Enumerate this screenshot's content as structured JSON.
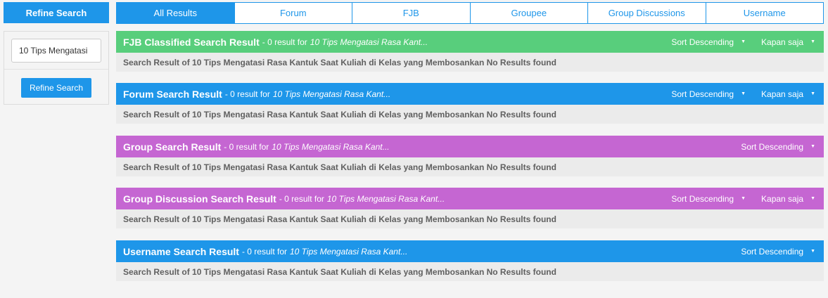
{
  "sidebar": {
    "header": "Refine Search",
    "input_value": "10 Tips Mengatasi",
    "button_label": "Refine Search"
  },
  "tabs": [
    {
      "label": "All Results",
      "active": true
    },
    {
      "label": "Forum",
      "active": false
    },
    {
      "label": "FJB",
      "active": false
    },
    {
      "label": "Groupee",
      "active": false
    },
    {
      "label": "Group Discussions",
      "active": false
    },
    {
      "label": "Username",
      "active": false
    }
  ],
  "sections": [
    {
      "title": "FJB Classified Search Result",
      "meta": "- 0 result for",
      "query": "10 Tips Mengatasi Rasa Kant...",
      "sort_label": "Sort Descending",
      "time_label": "Kapan saja",
      "message": "Search Result of 10 Tips Mengatasi Rasa Kantuk Saat Kuliah di Kelas yang Membosankan No Results found",
      "color": "#58ce7c"
    },
    {
      "title": "Forum Search Result",
      "meta": "- 0 result for",
      "query": "10 Tips Mengatasi Rasa Kant...",
      "sort_label": "Sort Descending",
      "time_label": "Kapan saja",
      "message": "Search Result of 10 Tips Mengatasi Rasa Kantuk Saat Kuliah di Kelas yang Membosankan No Results found",
      "color": "#1e96e9"
    },
    {
      "title": "Group Search Result",
      "meta": "- 0 result for",
      "query": "10 Tips Mengatasi Rasa Kant...",
      "sort_label": "Sort Descending",
      "message": "Search Result of 10 Tips Mengatasi Rasa Kantuk Saat Kuliah di Kelas yang Membosankan No Results found",
      "color": "#c566d2"
    },
    {
      "title": "Group Discussion Search Result",
      "meta": "- 0 result for",
      "query": "10 Tips Mengatasi Rasa Kant...",
      "sort_label": "Sort Descending",
      "time_label": "Kapan saja",
      "message": "Search Result of 10 Tips Mengatasi Rasa Kantuk Saat Kuliah di Kelas yang Membosankan No Results found",
      "color": "#c566d2"
    },
    {
      "title": "Username Search Result",
      "meta": "- 0 result for",
      "query": "10 Tips Mengatasi Rasa Kant...",
      "sort_label": "Sort Descending",
      "message": "Search Result of 10 Tips Mengatasi Rasa Kantuk Saat Kuliah di Kelas yang Membosankan No Results found",
      "color": "#1e96e9"
    }
  ]
}
